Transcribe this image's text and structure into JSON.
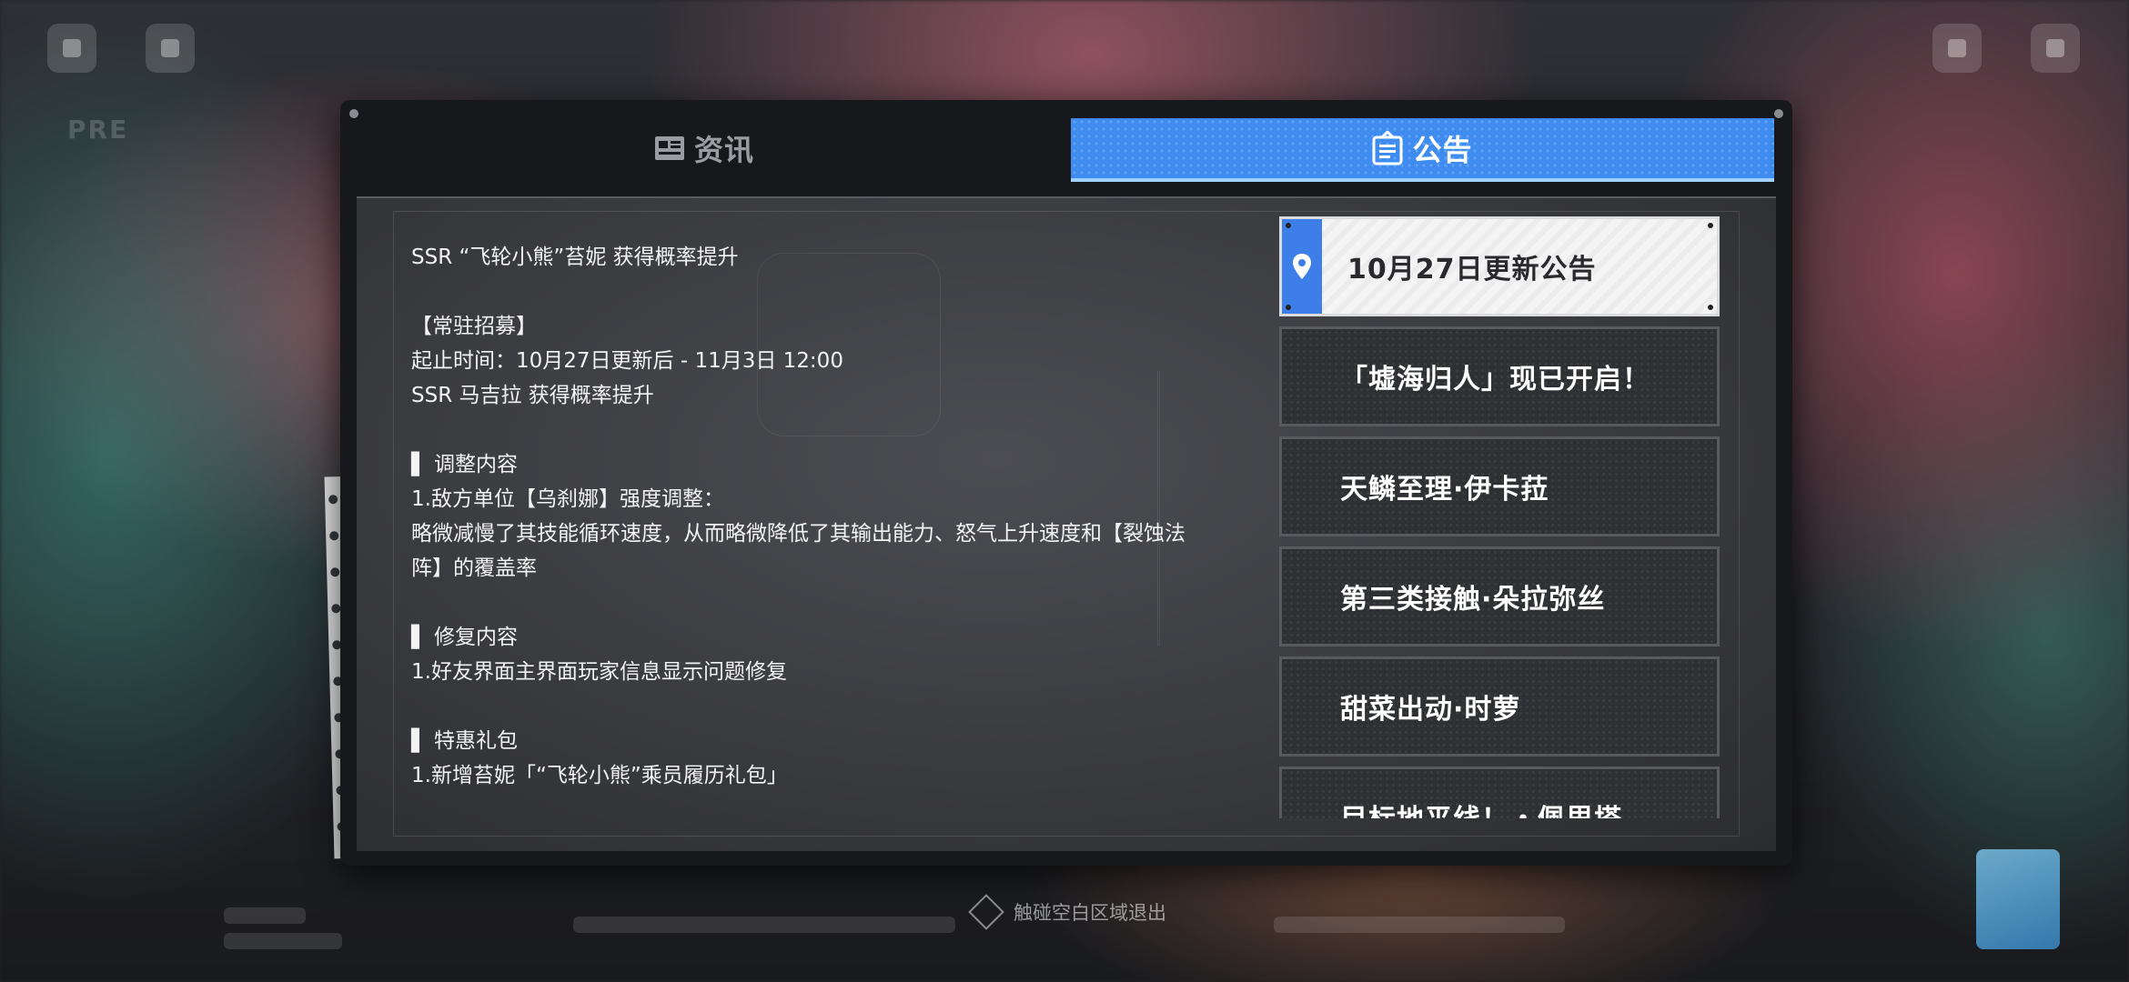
{
  "tabs": [
    {
      "label": "资讯",
      "icon": "newspaper-icon",
      "active": false
    },
    {
      "label": "公告",
      "icon": "clipboard-icon",
      "active": true
    }
  ],
  "article": {
    "lines": [
      "SSR “飞轮小熊”苔妮 获得概率提升",
      "",
      "【常驻招募】",
      "起止时间：10月27日更新后 - 11月3日 12:00",
      "SSR 马吉拉 获得概率提升",
      "",
      "▌ 调整内容",
      "1.敌方单位【乌刹娜】强度调整：",
      "略微减慢了其技能循环速度，从而略微降低了其输出能力、怒气上升速度和【裂蚀法",
      "阵】的覆盖率",
      "",
      "▌ 修复内容",
      "1.好友界面主界面玩家信息显示问题修复",
      "",
      "▌ 特惠礼包",
      "1.新增苔妮「“飞轮小熊”乘员履历礼包」"
    ]
  },
  "announcements": [
    {
      "label": "10月27日更新公告",
      "active": true,
      "icon": "location-pin-icon"
    },
    {
      "label": "「墟海归人」现已开启！",
      "active": false
    },
    {
      "label": "天鳞至理·伊卡菈",
      "active": false
    },
    {
      "label": "第三类接触·朵拉弥丝",
      "active": false
    },
    {
      "label": "甜菜出动·时萝",
      "active": false
    },
    {
      "label": "目标地平线！・佩里塔",
      "active": false
    }
  ],
  "footer": {
    "exit_hint": "触碰空白区域退出"
  },
  "colors": {
    "accent": "#3e8cf0",
    "panel": "#17181b",
    "active_item": "#f4f4f4"
  }
}
